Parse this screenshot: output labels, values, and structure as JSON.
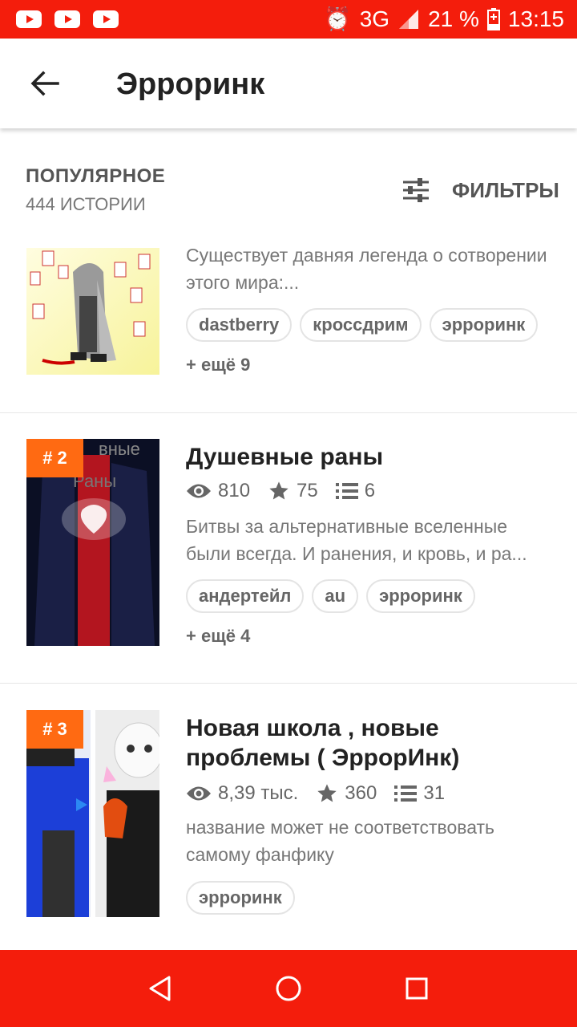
{
  "status_bar": {
    "alarm": "⏰",
    "network": "3G",
    "battery": "21 %",
    "time": "13:15",
    "bg_color": "#f41d0c"
  },
  "app_bar": {
    "title": "Эрроринк"
  },
  "section": {
    "title": "ПОПУЛЯРНОЕ",
    "count": "444 ИСТОРИИ",
    "filters_label": "ФИЛЬТРЫ"
  },
  "stories": [
    {
      "description": "Существует давняя легенда о сотворении этого мира:...",
      "tags": [
        "dastberry",
        "кроссдрим",
        "эрроринк"
      ],
      "more": "+ ещё 9"
    },
    {
      "rank": "# 2",
      "title": "Душевные раны",
      "views": "810",
      "votes": "75",
      "parts": "6",
      "description": "Битвы за альтернативные вселенные были всегда. И ранения, и кровь, и ра...",
      "tags": [
        "андертейл",
        "au",
        "эрроринк"
      ],
      "more": "+ ещё 4"
    },
    {
      "rank": "# 3",
      "title": "Новая школа , новые проблемы ( ЭррорИнк)",
      "views": "8,39 тыс.",
      "votes": "360",
      "parts": "31",
      "description": "название может не соответствовать самому фанфику",
      "tags": [
        "эрроринк"
      ]
    }
  ],
  "colors": {
    "accent": "#f41d0c",
    "rank_badge": "#ff6a12"
  }
}
